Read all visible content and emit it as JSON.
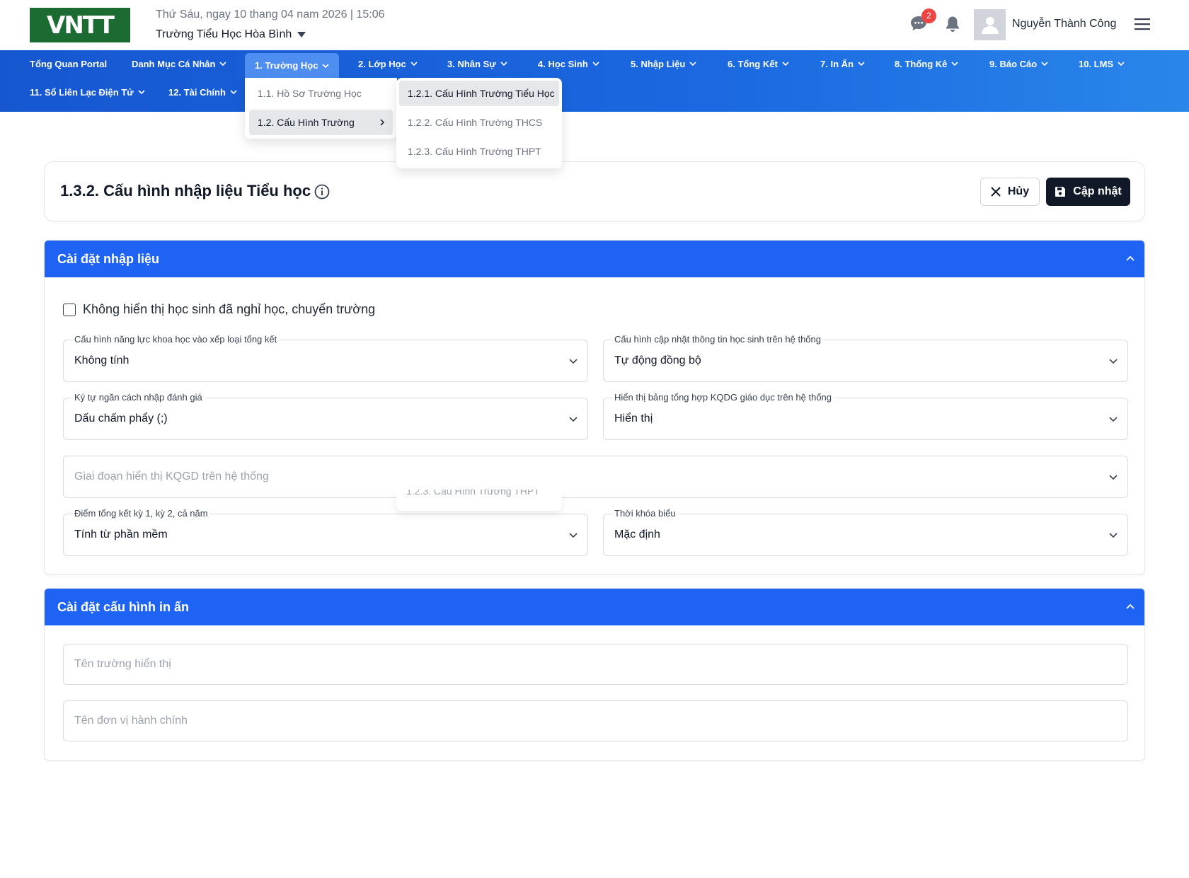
{
  "header": {
    "logo_text": "VNTT",
    "date_text": "Thứ Sáu, ngay 10 thang 04 nam 2026 | 15:06",
    "school_name": "Trường Tiểu Học Hòa Bình",
    "messages_badge": "2",
    "user_name": "Nguyễn Thành Công"
  },
  "nav": {
    "items": [
      {
        "label": "Tổng Quan Portal"
      },
      {
        "label": "Danh Mục Cá Nhân"
      },
      {
        "label": "1. Trường Học"
      },
      {
        "label": "2. Lớp Học"
      },
      {
        "label": "3. Nhân Sự"
      },
      {
        "label": "4. Học Sinh"
      },
      {
        "label": "5. Nhập Liệu"
      },
      {
        "label": "6. Tổng Kết"
      },
      {
        "label": "7. In Ấn"
      },
      {
        "label": "8. Thống Kê"
      },
      {
        "label": "9. Báo Cáo"
      },
      {
        "label": "10. LMS"
      },
      {
        "label": "11. Sổ Liên Lạc Điện Tử"
      },
      {
        "label": "12. Tài Chính"
      }
    ],
    "submenu": [
      {
        "label": "1.1. Hồ Sơ Trường Học"
      },
      {
        "label": "1.2. Cấu Hình Trường"
      }
    ],
    "submenu2": [
      {
        "label": "1.2.1. Cấu Hình Trường Tiểu Học"
      },
      {
        "label": "1.2.2. Cấu Hình Trường THCS"
      },
      {
        "label": "1.2.3. Cấu Hình Trường THPT"
      }
    ]
  },
  "page": {
    "title": "1.3.2. Cấu hình nhập liệu Tiểu học",
    "cancel_label": "Hủy",
    "update_label": "Cập nhật"
  },
  "section1": {
    "heading": "Cài đặt nhập liệu",
    "checkbox_label": "Không hiển thị học sinh đã nghỉ học, chuyển trường",
    "checkbox_checked": false,
    "fields": {
      "science": {
        "label": "Cấu hình năng lực khoa học vào xếp loại tổng kết",
        "value": "Không tính"
      },
      "sync": {
        "label": "Cấu hình cập nhật thông tin học sinh trên hệ thống",
        "value": "Tự động đồng bộ"
      },
      "separator": {
        "label": "Ký tự ngăn cách nhập đánh giá",
        "value": "Dấu chấm phẩy (;)"
      },
      "summary_table": {
        "label": "Hiển thị bảng tổng hợp KQDG giáo dục trên hệ thống",
        "value": "Hiển thị"
      },
      "phase": {
        "placeholder": "Giai đoạn hiển thị KQGD trên hệ thống"
      },
      "final_score": {
        "label": "Điểm tổng kết kỳ 1, kỳ 2, cả năm",
        "value": "Tính từ phần mềm"
      },
      "timetable": {
        "label": "Thời khóa biểu",
        "value": "Mặc định"
      }
    }
  },
  "section2": {
    "heading": "Cài đặt cấu hình in ấn",
    "fields": {
      "school_display": {
        "placeholder": "Tên trường hiển thị"
      },
      "admin_unit": {
        "placeholder": "Tên đơn vị hành chính"
      }
    }
  },
  "colors": {
    "brand_green": "#1b6b33",
    "nav_blue": "#1657d0",
    "section_blue": "#1f63f5",
    "badge_red": "#ef4444",
    "dark_button": "#111827"
  }
}
